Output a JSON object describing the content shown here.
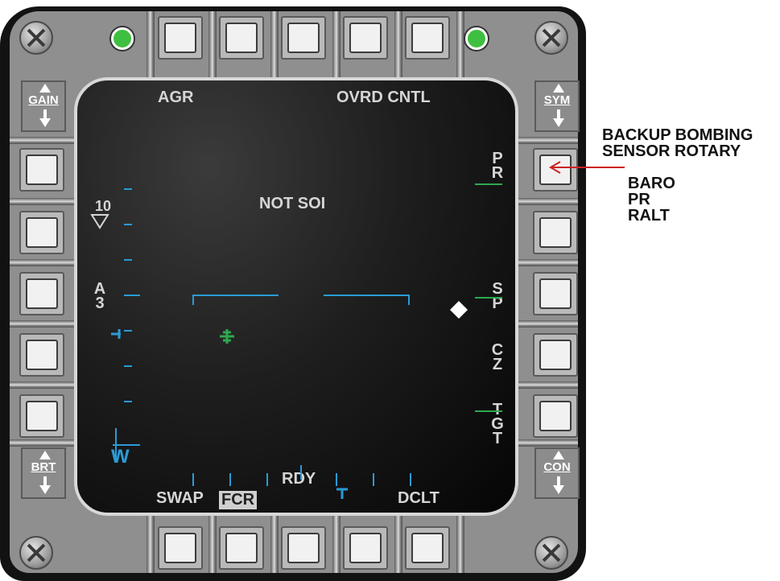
{
  "mfd": {
    "left_rocker_top": "GAIN",
    "left_rocker_bottom": "BRT",
    "right_rocker_top": "SYM",
    "right_rocker_bottom": "CON"
  },
  "display": {
    "top_left": "AGR",
    "top_right": "OVRD CNTL",
    "center_status": "NOT SOI",
    "range_value": "10",
    "azimuth_scan_top": "A",
    "azimuth_scan_bottom": "3",
    "right_osb6": "PR",
    "right_osb8": "SP",
    "right_osb9": "CZ",
    "right_osb10": "TGT",
    "bottom_swap": "SWAP",
    "bottom_fcr": "FCR",
    "bottom_rdy": "RDY",
    "bottom_dclt": "DCLT",
    "waterline": "W"
  },
  "annotation": {
    "line1": "BACKUP BOMBING",
    "line2": "SENSOR ROTARY",
    "options": [
      "BARO",
      "PR",
      "RALT"
    ],
    "arrow_color": "#cc2222"
  },
  "colors": {
    "symbology_blue": "#2a9bd6",
    "symbology_green": "#2fa84f",
    "led_green": "#3fbf3f"
  }
}
